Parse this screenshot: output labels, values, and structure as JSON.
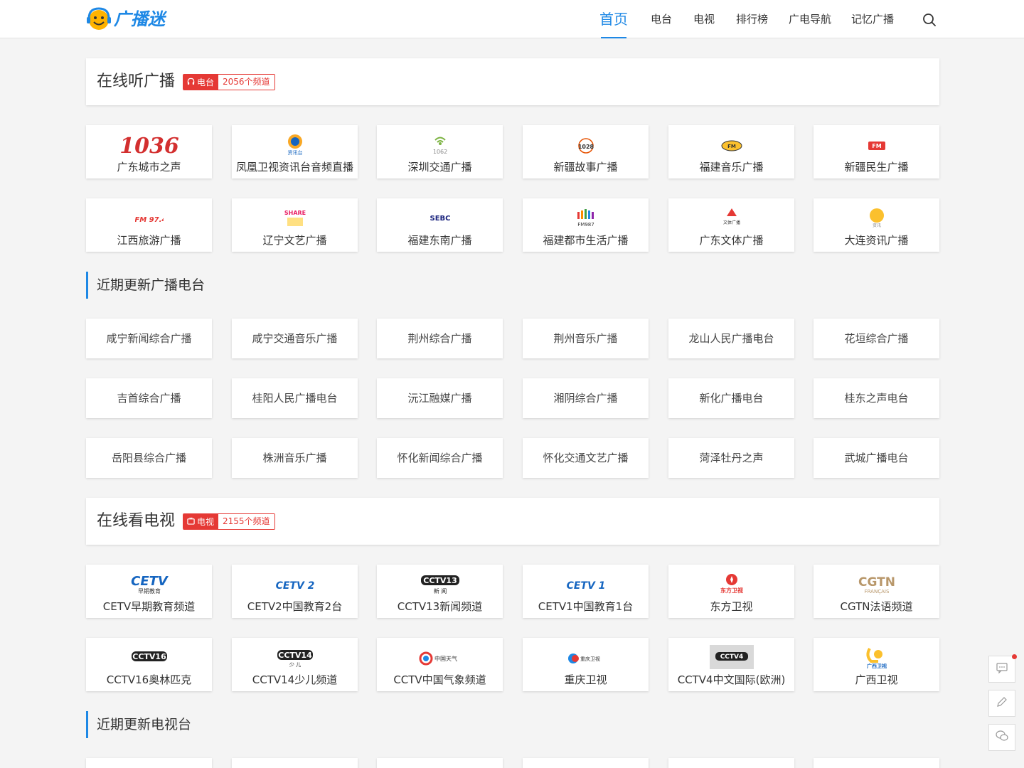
{
  "header": {
    "logo_text": "广播迷",
    "nav": [
      {
        "label": "首页",
        "active": true
      },
      {
        "label": "电台"
      },
      {
        "label": "电视"
      },
      {
        "label": "排行榜"
      },
      {
        "label": "广电导航"
      },
      {
        "label": "记忆广播"
      }
    ],
    "search_icon": "search-icon"
  },
  "radio_section": {
    "title": "在线听广播",
    "badge_label": "电台",
    "badge_count": "2056个频道",
    "featured": [
      {
        "name": "广东城市之声",
        "logo_text": "1036"
      },
      {
        "name": "凤凰卫视资讯台音频直播",
        "logo_text": "资讯台"
      },
      {
        "name": "深圳交通广播",
        "logo_text": "1062"
      },
      {
        "name": "新疆故事广播",
        "logo_text": "1028"
      },
      {
        "name": "福建音乐广播",
        "logo_text": "FM"
      },
      {
        "name": "新疆民生广播",
        "logo_text": "FM"
      },
      {
        "name": "江西旅游广播",
        "logo_text": "IFM 97.4"
      },
      {
        "name": "辽宁文艺广播",
        "logo_text": "SHARE"
      },
      {
        "name": "福建东南广播",
        "logo_text": "SEBC"
      },
      {
        "name": "福建都市生活广播",
        "logo_text": "FM987"
      },
      {
        "name": "广东文体广播",
        "logo_text": "文体广播"
      },
      {
        "name": "大连资讯广播",
        "logo_text": "资讯"
      }
    ],
    "recent_title": "近期更新广播电台",
    "recent": [
      "咸宁新闻综合广播",
      "咸宁交通音乐广播",
      "荆州综合广播",
      "荆州音乐广播",
      "龙山人民广播电台",
      "花垣综合广播",
      "吉首综合广播",
      "桂阳人民广播电台",
      "沅江融媒广播",
      "湘阴综合广播",
      "新化广播电台",
      "桂东之声电台",
      "岳阳县综合广播",
      "株洲音乐广播",
      "怀化新闻综合广播",
      "怀化交通文艺广播",
      "菏泽牡丹之声",
      "武城广播电台"
    ]
  },
  "tv_section": {
    "title": "在线看电视",
    "badge_label": "电视",
    "badge_count": "2155个频道",
    "featured": [
      {
        "name": "CETV早期教育频道",
        "logo_text": "CETV",
        "logo_sub": "早期教育"
      },
      {
        "name": "CETV2中国教育2台",
        "logo_text": "CETV 2"
      },
      {
        "name": "CCTV13新闻频道",
        "logo_text": "CCTV13",
        "logo_sub": "新 闻"
      },
      {
        "name": "CETV1中国教育1台",
        "logo_text": "CETV 1"
      },
      {
        "name": "东方卫视",
        "logo_text": "东方卫视"
      },
      {
        "name": "CGTN法语频道",
        "logo_text": "CGTN",
        "logo_sub": "FRANÇAIS"
      },
      {
        "name": "CCTV16奥林匹克",
        "logo_text": "CCTV16"
      },
      {
        "name": "CCTV14少儿频道",
        "logo_text": "CCTV14",
        "logo_sub": "少 儿"
      },
      {
        "name": "CCTV中国气象频道",
        "logo_text": "中国天气"
      },
      {
        "name": "重庆卫视",
        "logo_text": "重庆卫视"
      },
      {
        "name": "CCTV4中文国际(欧洲)",
        "logo_text": "CCTV4"
      },
      {
        "name": "广西卫视",
        "logo_text": "广西卫视"
      }
    ],
    "recent_title": "近期更新电视台"
  },
  "side_tools": [
    {
      "icon": "comment-icon"
    },
    {
      "icon": "edit-icon"
    },
    {
      "icon": "wechat-icon"
    }
  ]
}
